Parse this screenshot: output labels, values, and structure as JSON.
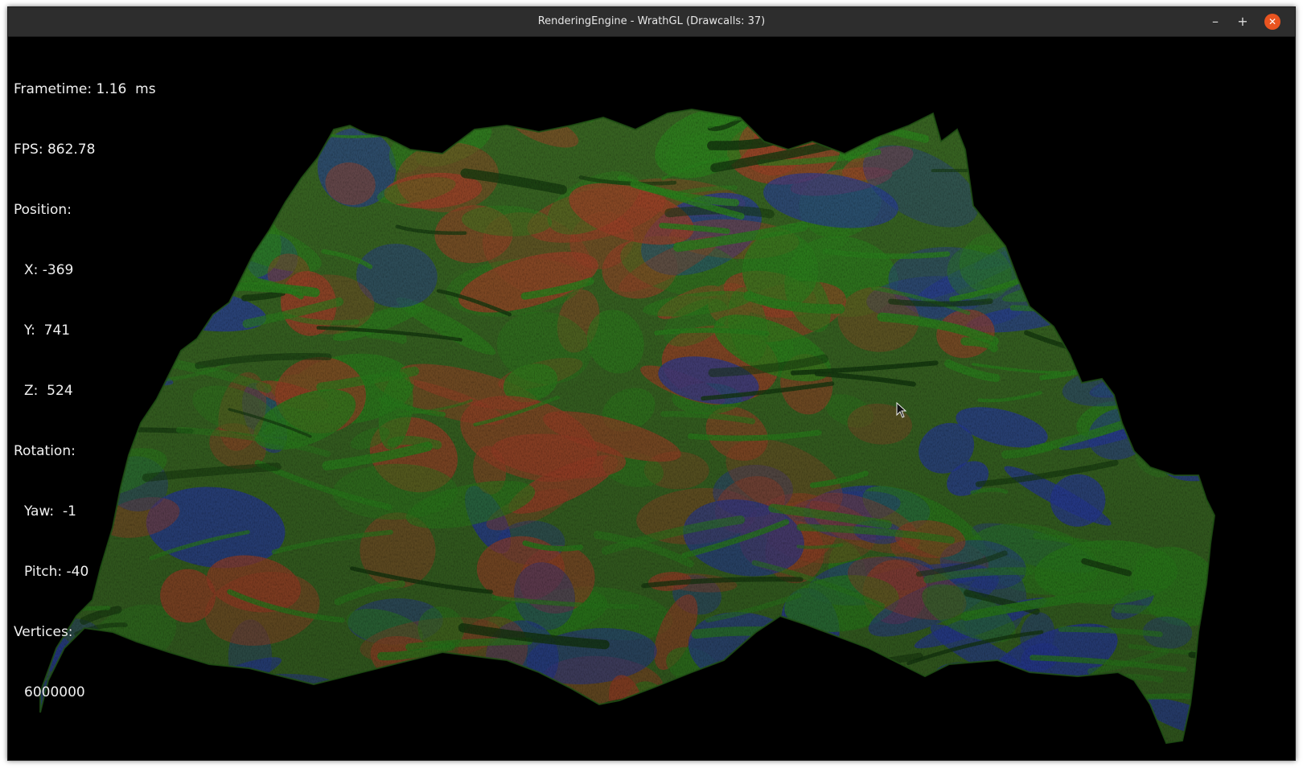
{
  "window": {
    "title": "RenderingEngine - WrathGL (Drawcalls: 37)",
    "minimize_label": "–",
    "maximize_label": "+",
    "close_label": "✕",
    "accent_close": "#e95420"
  },
  "hud": {
    "frametime": "Frametime: 1.16  ms",
    "fps": "FPS: 862.78",
    "position_label": "Position:",
    "x": "X: -369",
    "y": "Y:  741",
    "z": "Z:  524",
    "rotation_label": "Rotation:",
    "yaw": "Yaw:  -1",
    "pitch": "Pitch: -40",
    "vertices_label": "Vertices:",
    "vertices": "6000000"
  },
  "scene": {
    "colors": {
      "green": "#2e8a1e",
      "red": "#a8452a",
      "blue": "#2a3fa8",
      "background": "#000000"
    }
  }
}
